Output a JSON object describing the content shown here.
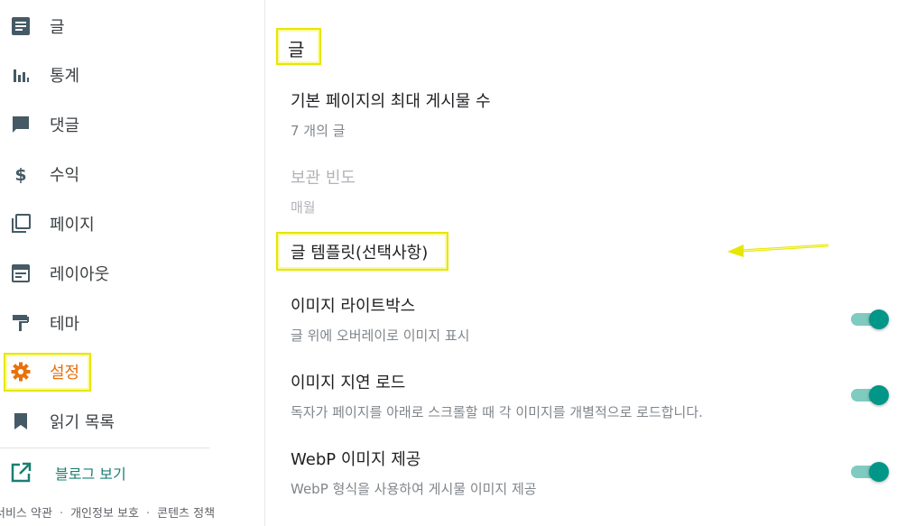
{
  "sidebar": {
    "items": [
      {
        "label": "글",
        "icon": "posts-icon"
      },
      {
        "label": "통계",
        "icon": "stats-icon"
      },
      {
        "label": "댓글",
        "icon": "comments-icon"
      },
      {
        "label": "수익",
        "icon": "dollar-icon"
      },
      {
        "label": "페이지",
        "icon": "pages-icon"
      },
      {
        "label": "레이아웃",
        "icon": "layout-icon"
      },
      {
        "label": "테마",
        "icon": "paint-roller-icon"
      },
      {
        "label": "설정",
        "icon": "gear-icon",
        "active": true
      },
      {
        "label": "읽기 목록",
        "icon": "bookmark-icon"
      }
    ],
    "view_blog": {
      "label": "블로그 보기",
      "icon": "open-external-icon"
    }
  },
  "footer": {
    "terms": "서비스 약관",
    "privacy": "개인정보 보호",
    "content_policy": "콘텐츠 정책",
    "separator": "·"
  },
  "main": {
    "section_title": "글",
    "settings": [
      {
        "title": "기본 페이지의 최대 게시물 수",
        "desc": "7 개의 글"
      },
      {
        "title": "보관 빈도",
        "desc": "매월",
        "disabled": true
      }
    ],
    "template_title": "글 템플릿(선택사항)",
    "toggles": [
      {
        "title": "이미지 라이트박스",
        "desc": "글 위에 오버레이로 이미지 표시",
        "on": true
      },
      {
        "title": "이미지 지연 로드",
        "desc": "독자가 페이지를 아래로 스크롤할 때 각 이미지를 개별적으로 로드합니다.",
        "on": true
      },
      {
        "title": "WebP 이미지 제공",
        "desc": "WebP 형식을 사용하여 게시물 이미지 제공",
        "on": true
      }
    ]
  },
  "colors": {
    "active": "#e8710a",
    "highlight": "#e6e600",
    "toggle_on": "#009688",
    "link": "#1a7f73"
  }
}
